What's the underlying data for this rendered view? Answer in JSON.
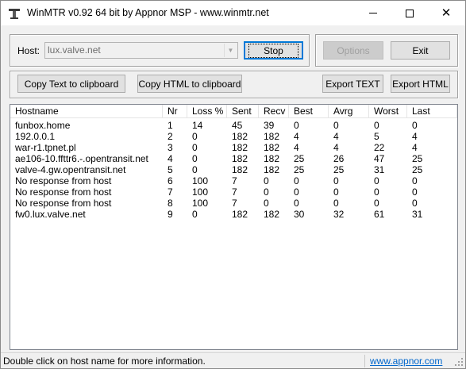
{
  "window": {
    "title": "WinMTR v0.92 64 bit by Appnor MSP - www.winmtr.net"
  },
  "host": {
    "label": "Host:",
    "value": "lux.valve.net"
  },
  "buttons": {
    "stop": "Stop",
    "options": "Options",
    "exit": "Exit",
    "copy_text": "Copy Text to clipboard",
    "copy_html": "Copy HTML to clipboard",
    "export_text": "Export TEXT",
    "export_html": "Export HTML"
  },
  "table": {
    "columns": [
      "Hostname",
      "Nr",
      "Loss %",
      "Sent",
      "Recv",
      "Best",
      "Avrg",
      "Worst",
      "Last"
    ],
    "rows": [
      [
        "funbox.home",
        "1",
        "14",
        "45",
        "39",
        "0",
        "0",
        "0",
        "0"
      ],
      [
        "192.0.0.1",
        "2",
        "0",
        "182",
        "182",
        "4",
        "4",
        "5",
        "4"
      ],
      [
        "war-r1.tpnet.pl",
        "3",
        "0",
        "182",
        "182",
        "4",
        "4",
        "22",
        "4"
      ],
      [
        "ae106-10.ffttr6.-.opentransit.net",
        "4",
        "0",
        "182",
        "182",
        "25",
        "26",
        "47",
        "25"
      ],
      [
        "valve-4.gw.opentransit.net",
        "5",
        "0",
        "182",
        "182",
        "25",
        "25",
        "31",
        "25"
      ],
      [
        "No response from host",
        "6",
        "100",
        "7",
        "0",
        "0",
        "0",
        "0",
        "0"
      ],
      [
        "No response from host",
        "7",
        "100",
        "7",
        "0",
        "0",
        "0",
        "0",
        "0"
      ],
      [
        "No response from host",
        "8",
        "100",
        "7",
        "0",
        "0",
        "0",
        "0",
        "0"
      ],
      [
        "fw0.lux.valve.net",
        "9",
        "0",
        "182",
        "182",
        "30",
        "32",
        "61",
        "31"
      ]
    ]
  },
  "statusbar": {
    "message": "Double click on host name for more information.",
    "link": "www.appnor.com"
  },
  "colors": {
    "focus_border": "#0078d7",
    "link": "#0066cc",
    "disabled_text": "#a0a0a0"
  }
}
